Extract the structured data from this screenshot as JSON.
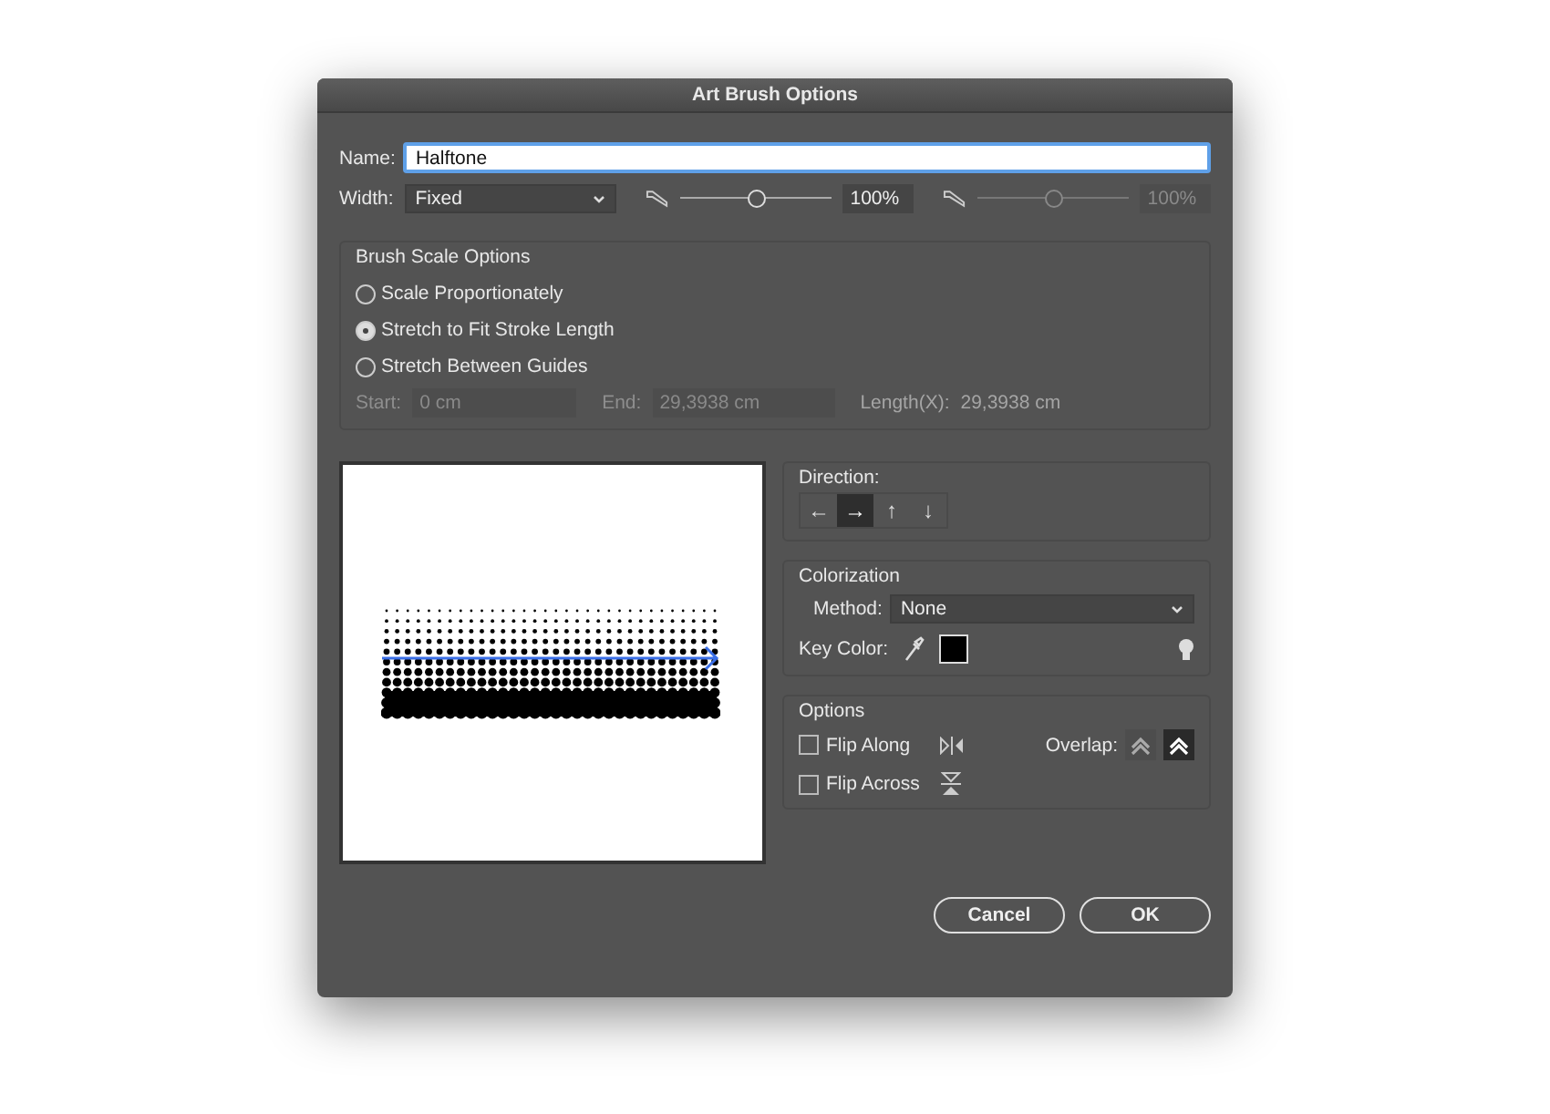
{
  "window": {
    "title": "Art Brush Options"
  },
  "name": {
    "label": "Name:",
    "value": "Halftone"
  },
  "width": {
    "label": "Width:",
    "value": "Fixed",
    "sliders": [
      {
        "level": 0.5,
        "value": "100%",
        "disabled": false
      },
      {
        "level": 0.5,
        "value": "100%",
        "disabled": true
      }
    ]
  },
  "brush_scale": {
    "title": "Brush Scale Options",
    "options": [
      {
        "label": "Scale Proportionately",
        "selected": false
      },
      {
        "label": "Stretch to Fit Stroke Length",
        "selected": true
      },
      {
        "label": "Stretch Between Guides",
        "selected": false
      }
    ],
    "start": {
      "label": "Start:",
      "value": "0 cm"
    },
    "end": {
      "label": "End:",
      "value": "29,3938 cm"
    },
    "length": {
      "label": "Length(X):",
      "value": "29,3938 cm"
    }
  },
  "preview": {
    "kind": "halftone"
  },
  "direction": {
    "label": "Direction:",
    "buttons": [
      {
        "glyph": "←",
        "selected": false
      },
      {
        "glyph": "→",
        "selected": true
      },
      {
        "glyph": "↑",
        "selected": false
      },
      {
        "glyph": "↓",
        "selected": false
      }
    ]
  },
  "colorization": {
    "title": "Colorization",
    "method_label": "Method:",
    "method": "None",
    "key_color_label": "Key Color:",
    "key_color_swatch": {
      "color": "#000000"
    }
  },
  "options": {
    "title": "Options",
    "flip_along": {
      "label": "Flip Along",
      "checked": false
    },
    "flip_across": {
      "label": "Flip Across",
      "checked": false
    },
    "overlap_label": "Overlap:",
    "overlap": [
      {
        "selected": false
      },
      {
        "selected": true
      }
    ]
  },
  "buttons": [
    {
      "label": "Cancel",
      "default": false
    },
    {
      "label": "OK",
      "default": false
    }
  ]
}
